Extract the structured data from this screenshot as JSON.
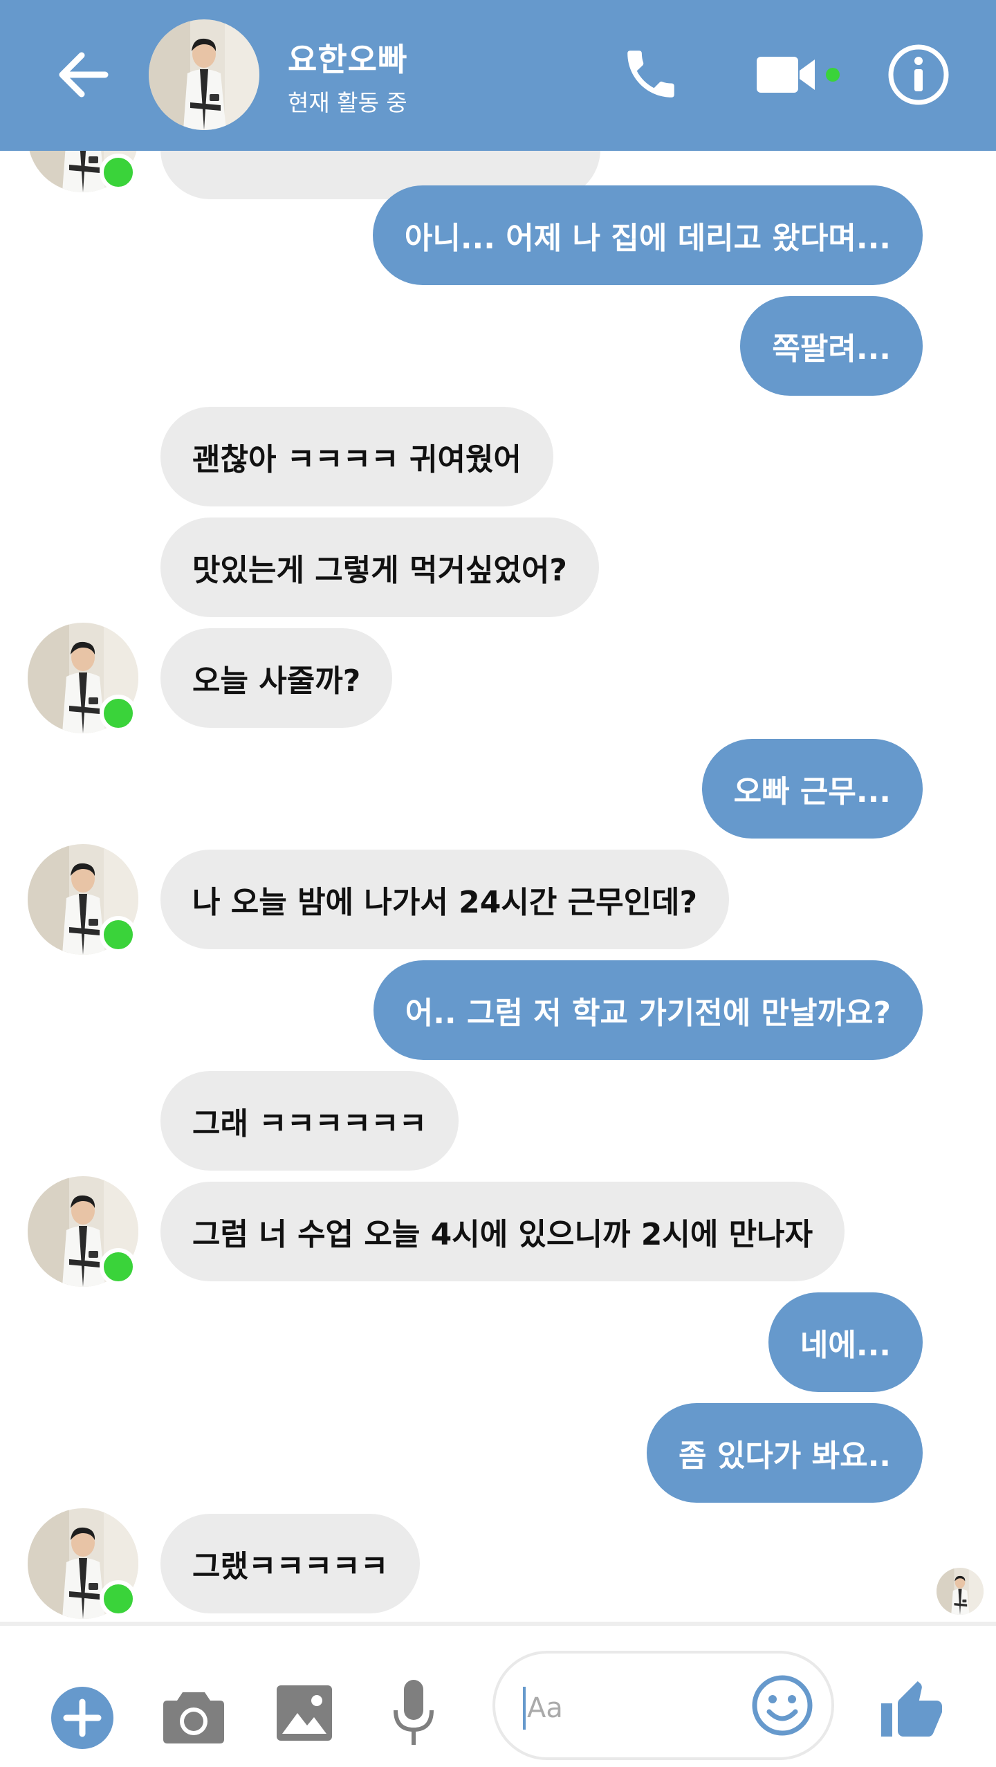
{
  "header": {
    "contact_name": "요한오빠",
    "status": "현재 활동 중",
    "icons": [
      "back-arrow-icon",
      "phone-icon",
      "video-camera-icon",
      "info-icon"
    ]
  },
  "messages": [
    {
      "side": "in",
      "text": ""
    },
    {
      "side": "out",
      "text": "아니... 어제 나 집에 데리고 왔다며..."
    },
    {
      "side": "out",
      "text": "쪽팔려..."
    },
    {
      "side": "in",
      "text": "괜찮아 ㅋㅋㅋㅋ 귀여웠어"
    },
    {
      "side": "in",
      "text": "맛있는게 그렇게 먹거싶었어?"
    },
    {
      "side": "in",
      "text": "오늘 사줄까?"
    },
    {
      "side": "out",
      "text": "오빠 근무..."
    },
    {
      "side": "in",
      "text": "나 오늘 밤에 나가서 24시간 근무인데?"
    },
    {
      "side": "out",
      "text": "어.. 그럼 저 학교 가기전에 만날까요?"
    },
    {
      "side": "in",
      "text": "그래 ㅋㅋㅋㅋㅋㅋ"
    },
    {
      "side": "in",
      "text": "그럼 너 수업 오늘 4시에 있으니까 2시에 만나자"
    },
    {
      "side": "out",
      "text": "네에..."
    },
    {
      "side": "out",
      "text": "좀 있다가 봐요.."
    },
    {
      "side": "in",
      "text": "그랬ㅋㅋㅋㅋㅋ"
    }
  ],
  "composer": {
    "placeholder": "Aa",
    "icons": [
      "plus-icon",
      "camera-icon",
      "image-icon",
      "microphone-icon",
      "emoji-icon",
      "thumbs-up-icon"
    ]
  },
  "colors": {
    "accent": "#6699cc",
    "incoming_bubble": "#ebebeb",
    "online": "#3ad33a"
  }
}
